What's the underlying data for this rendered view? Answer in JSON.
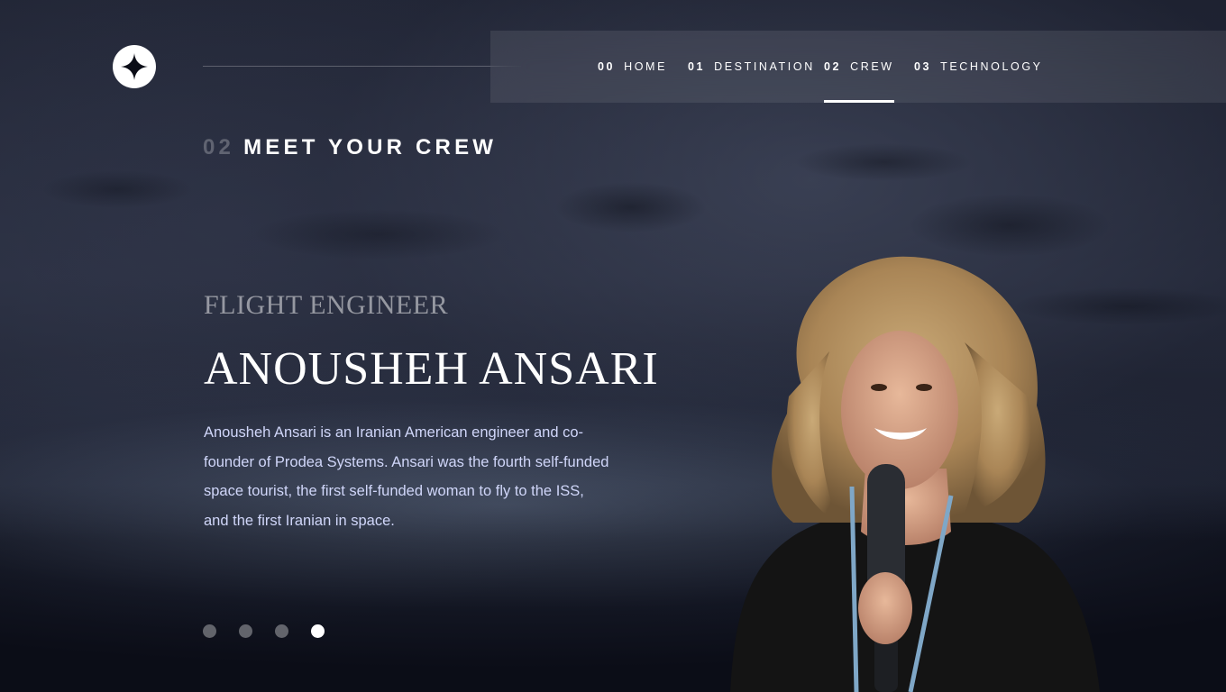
{
  "header": {
    "logo_icon": "star-logo-icon",
    "nav": [
      {
        "num": "00",
        "label": "HOME",
        "active": false
      },
      {
        "num": "01",
        "label": "DESTINATION",
        "active": false
      },
      {
        "num": "02",
        "label": "CREW",
        "active": true
      },
      {
        "num": "03",
        "label": "TECHNOLOGY",
        "active": false
      }
    ]
  },
  "page": {
    "eyebrow_num": "02",
    "eyebrow_text": "MEET YOUR CREW"
  },
  "crew": {
    "role": "FLIGHT ENGINEER",
    "name": "ANOUSHEH ANSARI",
    "bio": "Anousheh Ansari is an Iranian American engineer and co-founder of Prodea Systems. Ansari was the fourth self-funded space tourist, the first self-funded woman to fly to the ISS, and the first Iranian in space."
  },
  "pagination": {
    "count": 4,
    "active_index": 3
  },
  "colors": {
    "background": "#0b0d17",
    "text_light": "#d0d6f9",
    "white": "#ffffff"
  }
}
